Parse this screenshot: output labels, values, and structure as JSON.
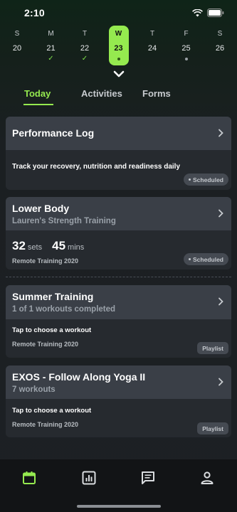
{
  "status_bar": {
    "time": "2:10"
  },
  "week": {
    "days": [
      {
        "letter": "S",
        "num": "20",
        "mark": "none"
      },
      {
        "letter": "M",
        "num": "21",
        "mark": "check"
      },
      {
        "letter": "T",
        "num": "22",
        "mark": "check"
      },
      {
        "letter": "W",
        "num": "23",
        "mark": "dot"
      },
      {
        "letter": "T",
        "num": "24",
        "mark": "none"
      },
      {
        "letter": "F",
        "num": "25",
        "mark": "dot"
      },
      {
        "letter": "S",
        "num": "26",
        "mark": "none"
      }
    ],
    "active_index": 3
  },
  "tabs": [
    {
      "label": "Today",
      "active": true
    },
    {
      "label": "Activities",
      "active": false
    },
    {
      "label": "Forms",
      "active": false
    }
  ],
  "cards": {
    "performance_log": {
      "title": "Performance Log",
      "body": "Track your recovery, nutrition and readiness daily",
      "badge": "Scheduled"
    },
    "lower_body": {
      "title": "Lower Body",
      "subtitle": "Lauren's Strength Training",
      "sets_value": "32",
      "sets_unit": "sets",
      "mins_value": "45",
      "mins_unit": "mins",
      "footer": "Remote Training 2020",
      "badge": "Scheduled"
    },
    "summer_training": {
      "title": "Summer Training",
      "subtitle": "1 of 1 workouts completed",
      "body": "Tap to choose a workout",
      "footer": "Remote Training 2020",
      "badge": "Playlist"
    },
    "exos": {
      "title": "EXOS - Follow Along Yoga II",
      "subtitle": "7 workouts",
      "body": "Tap to choose a workout",
      "footer": "Remote Training 2020",
      "badge": "Playlist"
    }
  },
  "bottom_nav": [
    {
      "icon": "calendar-icon",
      "active": true
    },
    {
      "icon": "chart-icon",
      "active": false
    },
    {
      "icon": "chat-icon",
      "active": false
    },
    {
      "icon": "profile-icon",
      "active": false
    }
  ],
  "colors": {
    "accent": "#95ea4f",
    "card_header": "#3a3f47",
    "card_body": "#262a2f"
  }
}
